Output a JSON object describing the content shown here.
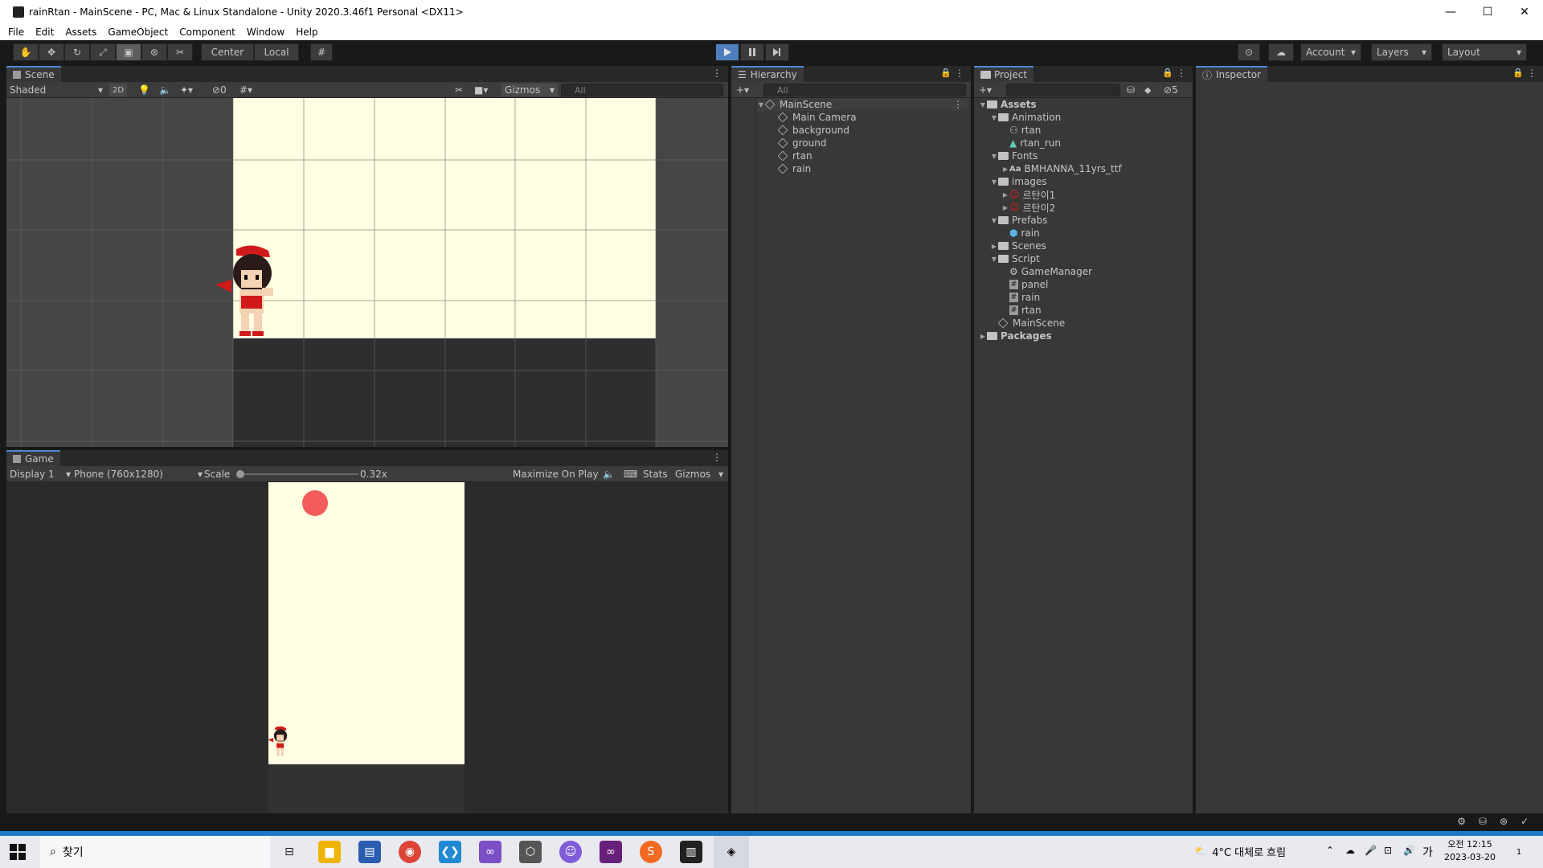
{
  "window": {
    "title": "rainRtan - MainScene - PC, Mac & Linux Standalone - Unity 2020.3.46f1 Personal <DX11>",
    "minimize": "—",
    "maximize": "☐",
    "close": "✕"
  },
  "menu": [
    "File",
    "Edit",
    "Assets",
    "GameObject",
    "Component",
    "Window",
    "Help"
  ],
  "toolbar": {
    "pivot": "Center",
    "space": "Local",
    "account": "Account",
    "layers": "Layers",
    "layout": "Layout"
  },
  "scene": {
    "tab": "Scene",
    "shading": "Shaded",
    "mode2d": "2D",
    "hidden_count": "0",
    "gizmos": "Gizmos",
    "search_placeholder": "All"
  },
  "game": {
    "tab": "Game",
    "display": "Display 1",
    "resolution": "Phone (760x1280)",
    "scale_label": "Scale",
    "scale_value": "0.32x",
    "maximize": "Maximize On Play",
    "stats": "Stats",
    "gizmos": "Gizmos"
  },
  "hierarchy": {
    "tab": "Hierarchy",
    "search_placeholder": "All",
    "scene": "MainScene",
    "items": [
      "Main Camera",
      "background",
      "ground",
      "rtan",
      "rain"
    ]
  },
  "project": {
    "tab": "Project",
    "hidden_count": "5",
    "tree": [
      {
        "label": "Assets",
        "depth": 0,
        "kind": "folder",
        "open": true,
        "bold": true
      },
      {
        "label": "Animation",
        "depth": 1,
        "kind": "folder",
        "open": true
      },
      {
        "label": "rtan",
        "depth": 2,
        "kind": "anim"
      },
      {
        "label": "rtan_run",
        "depth": 2,
        "kind": "clip"
      },
      {
        "label": "Fonts",
        "depth": 1,
        "kind": "folder",
        "open": true
      },
      {
        "label": "BMHANNA_11yrs_ttf",
        "depth": 2,
        "kind": "font",
        "collapsed": true
      },
      {
        "label": "images",
        "depth": 1,
        "kind": "folder",
        "open": true
      },
      {
        "label": "르탄이1",
        "depth": 2,
        "kind": "sprite",
        "collapsed": true
      },
      {
        "label": "르탄이2",
        "depth": 2,
        "kind": "sprite",
        "collapsed": true
      },
      {
        "label": "Prefabs",
        "depth": 1,
        "kind": "folder",
        "open": true
      },
      {
        "label": "rain",
        "depth": 2,
        "kind": "prefab"
      },
      {
        "label": "Scenes",
        "depth": 1,
        "kind": "folder",
        "collapsed": true
      },
      {
        "label": "Script",
        "depth": 1,
        "kind": "folder",
        "open": true
      },
      {
        "label": "GameManager",
        "depth": 2,
        "kind": "gear"
      },
      {
        "label": "panel",
        "depth": 2,
        "kind": "script"
      },
      {
        "label": "rain",
        "depth": 2,
        "kind": "script"
      },
      {
        "label": "rtan",
        "depth": 2,
        "kind": "script"
      },
      {
        "label": "MainScene",
        "depth": 1,
        "kind": "scene"
      },
      {
        "label": "Packages",
        "depth": 0,
        "kind": "folder",
        "collapsed": true,
        "bold": true
      }
    ]
  },
  "inspector": {
    "tab": "Inspector"
  },
  "taskbar": {
    "search": "찾기",
    "weather": "4°C 대체로 흐림",
    "ime": "가",
    "time": "오전 12:15",
    "date": "2023-03-20",
    "notifications": "1"
  },
  "colors": {
    "editor_bg": "#383838",
    "scene_canvas": "#fffee2",
    "raindrop": "#f25c5c",
    "play_active": "#4d7fbf"
  }
}
